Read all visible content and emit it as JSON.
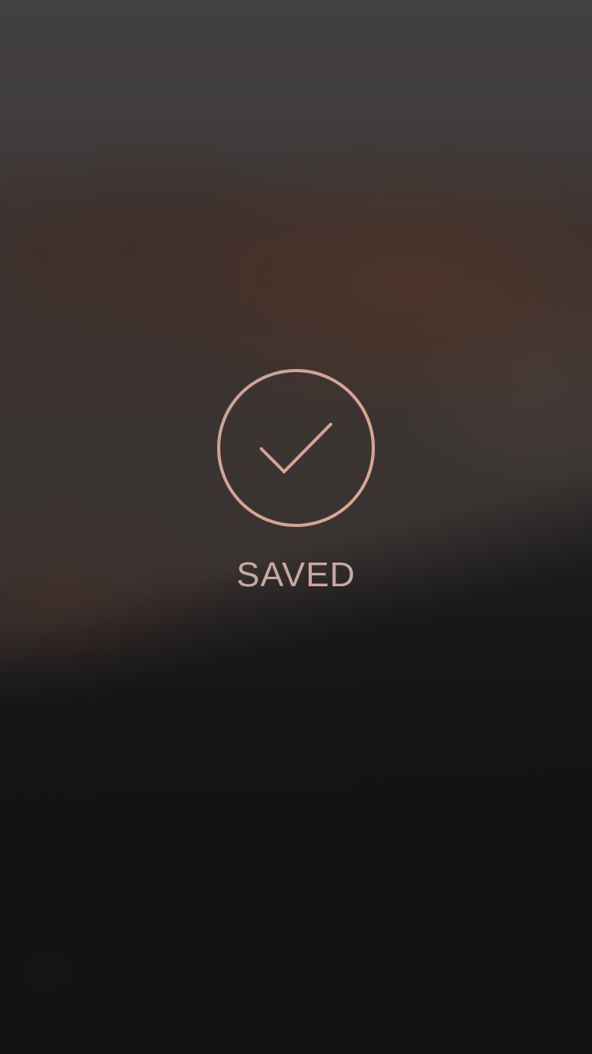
{
  "toast": {
    "status_label": "SAVED",
    "icon": "checkmark-circle-icon",
    "accent_color": "#d4a494",
    "label_color": "#c7a8a0"
  }
}
